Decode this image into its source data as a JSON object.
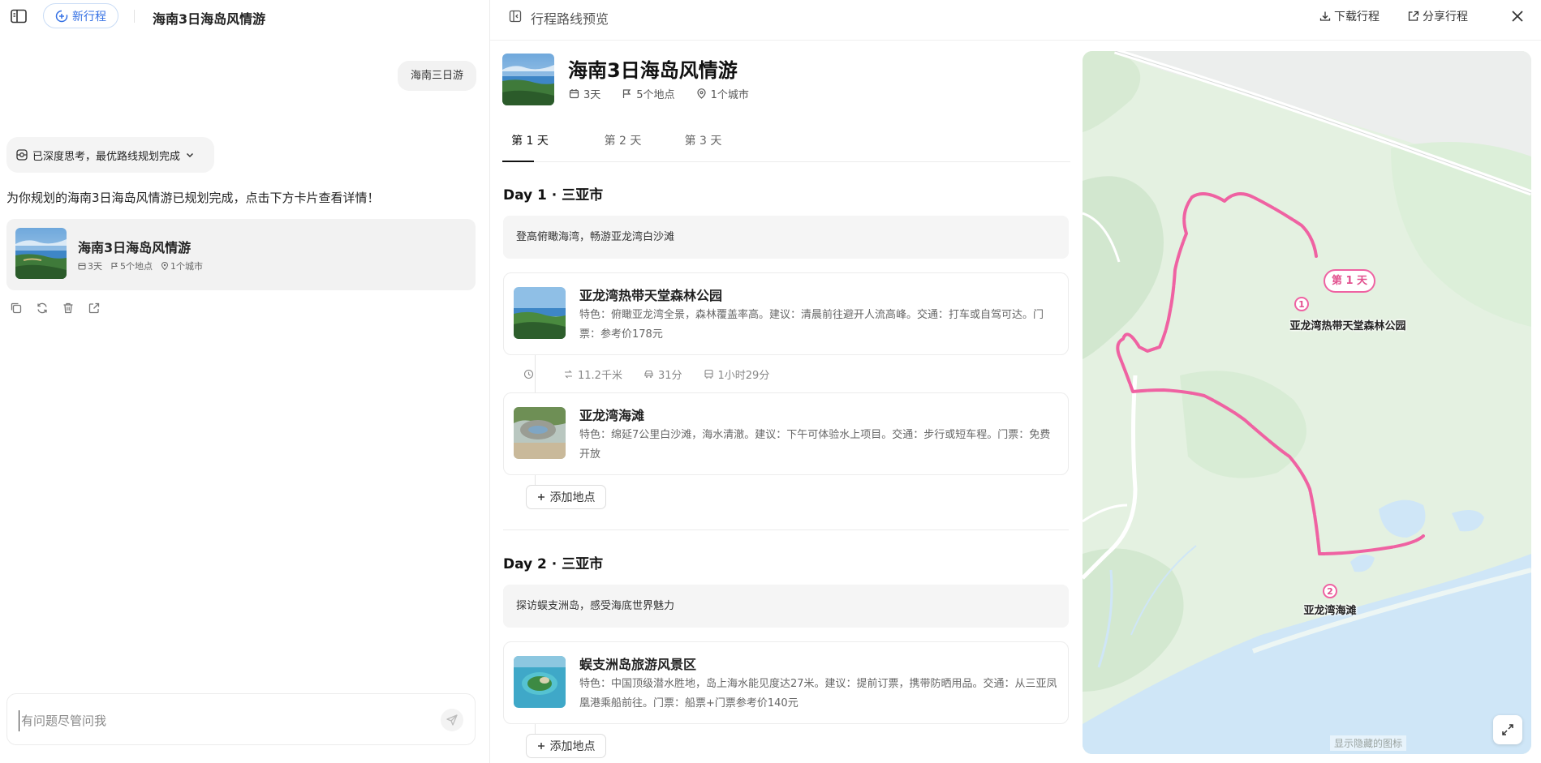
{
  "left": {
    "new_trip_label": "新行程",
    "chat_title": "海南3日海岛风情游",
    "user_message": "海南三日游",
    "thinking_status": "已深度思考，最优路线规划完成",
    "answer_text": "为你规划的海南3日海岛风情游已规划完成，点击下方卡片查看详情！",
    "trip_card": {
      "title": "海南3日海岛风情游",
      "days": "3天",
      "places": "5个地点",
      "cities": "1个城市"
    },
    "actions": [
      "copy-icon",
      "refresh-icon",
      "delete-icon",
      "share-icon"
    ],
    "input_placeholder": "有问题尽管问我"
  },
  "right": {
    "preview_title": "行程路线预览",
    "download_label": "下载行程",
    "share_label": "分享行程",
    "trip_name": "海南3日海岛风情游",
    "meta": {
      "days": "3天",
      "places": "5个地点",
      "cities": "1个城市"
    },
    "tabs": [
      "第 1 天",
      "第 2 天",
      "第 3 天"
    ],
    "active_tab": 0,
    "days": [
      {
        "title": "Day 1 · 三亚市",
        "subtitle": "登高俯瞰海湾，畅游亚龙湾白沙滩",
        "places": [
          {
            "name": "亚龙湾热带天堂森林公园",
            "desc": "特色：俯瞰亚龙湾全景，森林覆盖率高。建议：清晨前往避开人流高峰。交通：打车或自驾可达。门票：参考价178元"
          },
          {
            "name": "亚龙湾海滩",
            "desc": "特色：绵延7公里白沙滩，海水清澈。建议：下午可体验水上项目。交通：步行或短车程。门票：免费开放"
          }
        ],
        "transit": {
          "distance": "11.2千米",
          "drive": "31分",
          "bus": "1小时29分"
        },
        "add_label": "添加地点"
      },
      {
        "title": "Day 2 · 三亚市",
        "subtitle": "探访蜈支洲岛，感受海底世界魅力",
        "places": [
          {
            "name": "蜈支洲岛旅游风景区",
            "desc": "特色：中国顶级潜水胜地，岛上海水能见度达27米。建议：提前订票，携带防晒用品。交通：从三亚凤凰港乘船前往。门票：船票+门票参考价140元"
          }
        ],
        "add_label": "添加地点"
      }
    ],
    "map": {
      "day_tag": "第 1 天",
      "pins": [
        {
          "num": "1",
          "label": "亚龙湾热带天堂森林公园"
        },
        {
          "num": "2",
          "label": "亚龙湾海滩"
        }
      ],
      "show_hidden_label": "显示隐藏的图标",
      "route_color": "#ef62a2",
      "sea_color": "#cfe6f7",
      "land_color": "#e6f2e4"
    }
  }
}
